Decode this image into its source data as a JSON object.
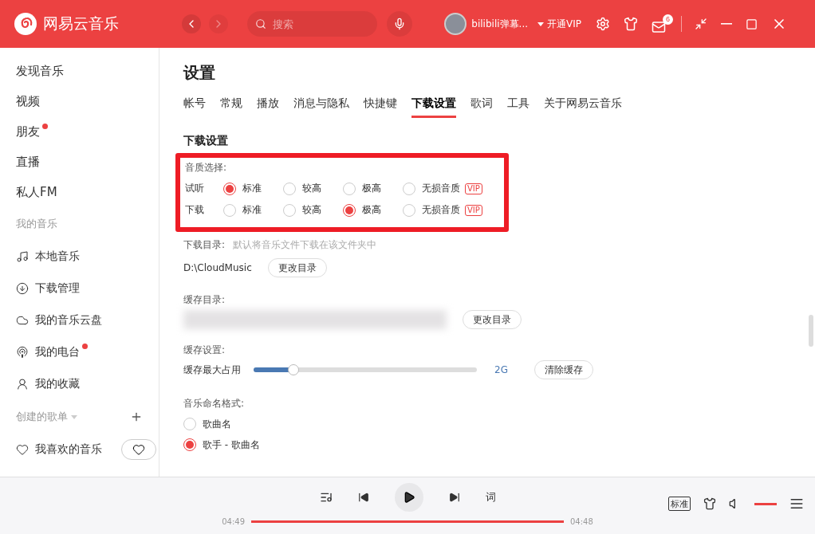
{
  "app": {
    "name": "网易云音乐"
  },
  "topbar": {
    "search": {
      "placeholder": "搜索"
    },
    "user": {
      "name": "bilibili弹幕..."
    },
    "vip_link": "开通VIP",
    "mail_count": "6"
  },
  "sidebar": {
    "items": [
      {
        "kind": "nav",
        "label": "发现音乐",
        "dot": false
      },
      {
        "kind": "nav",
        "label": "视频",
        "dot": false
      },
      {
        "kind": "nav",
        "label": "朋友",
        "dot": true
      },
      {
        "kind": "nav",
        "label": "直播",
        "dot": false
      },
      {
        "kind": "nav",
        "label": "私人FM",
        "dot": false
      },
      {
        "kind": "header",
        "label": "我的音乐"
      },
      {
        "kind": "icon",
        "label": "本地音乐",
        "dot": false
      },
      {
        "kind": "icon",
        "label": "下载管理",
        "dot": false
      },
      {
        "kind": "icon",
        "label": "我的音乐云盘",
        "dot": false
      },
      {
        "kind": "icon",
        "label": "我的电台",
        "dot": true
      },
      {
        "kind": "icon",
        "label": "我的收藏",
        "dot": false
      },
      {
        "kind": "playlist_header",
        "label": "创建的歌单"
      },
      {
        "kind": "liked",
        "label": "我喜欢的音乐"
      }
    ]
  },
  "settings": {
    "title": "设置",
    "tabs": [
      {
        "label": "帐号",
        "selected": false
      },
      {
        "label": "常规",
        "selected": false
      },
      {
        "label": "播放",
        "selected": false
      },
      {
        "label": "消息与隐私",
        "selected": false
      },
      {
        "label": "快捷键",
        "selected": false
      },
      {
        "label": "下载设置",
        "selected": true
      },
      {
        "label": "歌词",
        "selected": false
      },
      {
        "label": "工具",
        "selected": false
      },
      {
        "label": "关于网易云音乐",
        "selected": false
      }
    ],
    "section_title": "下载设置",
    "quality": {
      "label": "音质选择:",
      "rows": [
        {
          "label": "试听",
          "options": [
            {
              "label": "标准",
              "selected": true
            },
            {
              "label": "较高",
              "selected": false
            },
            {
              "label": "极高",
              "selected": false
            },
            {
              "label": "无损音质",
              "selected": false,
              "badge": "VIP"
            }
          ]
        },
        {
          "label": "下载",
          "options": [
            {
              "label": "标准",
              "selected": false
            },
            {
              "label": "较高",
              "selected": false
            },
            {
              "label": "极高",
              "selected": true
            },
            {
              "label": "无损音质",
              "selected": false,
              "badge": "VIP"
            }
          ]
        }
      ]
    },
    "download_dir": {
      "label": "下载目录:",
      "hint": "默认将音乐文件下载在该文件夹中",
      "path": "D:\\CloudMusic",
      "button": "更改目录"
    },
    "cache_dir": {
      "label": "缓存目录:",
      "button": "更改目录"
    },
    "cache": {
      "label": "缓存设置:",
      "slider_label": "缓存最大占用",
      "level": 0.18,
      "reading": "2G",
      "button": "清除缓存"
    },
    "naming": {
      "label": "音乐命名格式:",
      "options": [
        {
          "label": "歌曲名",
          "selected": false
        },
        {
          "label": "歌手 - 歌曲名",
          "selected": true
        }
      ]
    }
  },
  "player": {
    "elapsed": "04:49",
    "total": "04:48",
    "level": 1.0,
    "lyrics": "词",
    "quality": "标准",
    "volume": {
      "level": 1.0
    }
  }
}
